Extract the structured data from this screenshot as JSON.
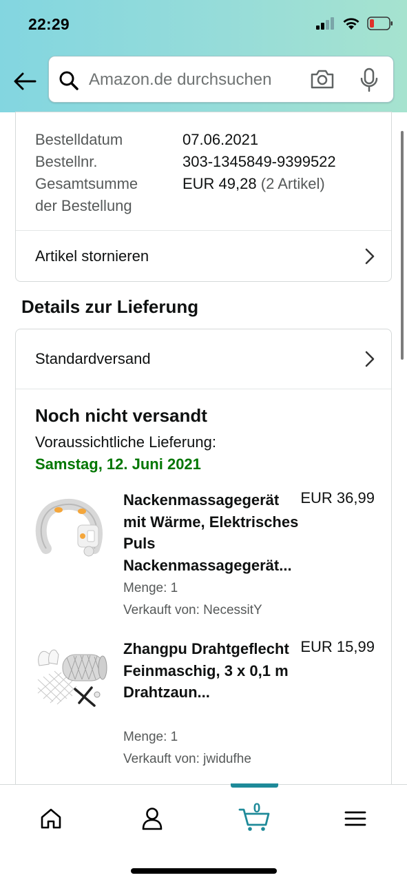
{
  "status_bar": {
    "time": "22:29"
  },
  "search": {
    "placeholder": "Amazon.de durchsuchen"
  },
  "order_summary": {
    "date_label": "Bestelldatum",
    "date_value": "07.06.2021",
    "number_label": "Bestellnr.",
    "number_value": "303-1345849-9399522",
    "total_label_line1": "Gesamtsumme",
    "total_label_line2": "der Bestellung",
    "total_value": "EUR 49,28",
    "total_items": "(2 Artikel)",
    "cancel_label": "Artikel stornieren"
  },
  "delivery": {
    "section_title": "Details zur Lieferung",
    "shipping_method": "Standardversand",
    "status": "Noch nicht versandt",
    "estimate_label": "Voraussichtliche Lieferung:",
    "estimate_date": "Samstag, 12. Juni 2021",
    "status_color": "#007600"
  },
  "items": [
    {
      "title": "Nackenmassagegerät mit Wärme, Elektrisches Puls Nackenmassagegerät...",
      "price": "EUR 36,99",
      "quantity": "Menge: 1",
      "seller": "Verkauft von: NecessitY"
    },
    {
      "title": "Zhangpu Drahtgeflecht Feinmaschig, 3 x 0,1 m Drahtzaun...",
      "price": "EUR 15,99",
      "quantity": "Menge: 1",
      "seller": "Verkauft von: jwidufhe"
    }
  ],
  "bottom_nav": {
    "cart_count": "0",
    "accent_color": "#1e8a99",
    "items": [
      "home-icon",
      "account-icon",
      "cart-icon",
      "menu-icon"
    ]
  }
}
